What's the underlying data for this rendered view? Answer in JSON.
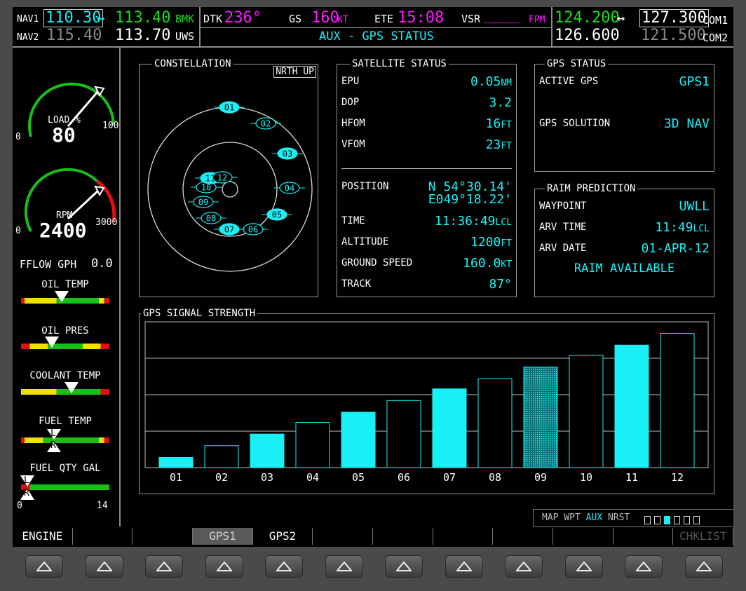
{
  "header": {
    "nav1": {
      "label": "NAV1",
      "active": "110.30",
      "arrow": "↔",
      "standby": "113.40",
      "id": "BMK"
    },
    "nav2": {
      "label": "NAV2",
      "active": "115.40",
      "standby": "113.70",
      "id": "UWS"
    },
    "dtk": {
      "label": "DTK",
      "value": "236°"
    },
    "gs": {
      "label": "GS",
      "value": "160",
      "unit": "KT"
    },
    "ete": {
      "label": "ETE",
      "value": "15:08"
    },
    "vsr": {
      "label": "VSR",
      "value": "_____",
      "unit": "FPM"
    },
    "page_title": "AUX - GPS STATUS",
    "com1": {
      "label": "COM1",
      "active": "124.200",
      "arrow": "↔",
      "standby": "127.300"
    },
    "com2": {
      "label": "COM2",
      "active": "126.600",
      "standby": "121.500"
    }
  },
  "engine": {
    "load": {
      "label": "LOAD %",
      "value": "80",
      "min": "0",
      "max": "100"
    },
    "rpm": {
      "label": "RPM",
      "value": "2400",
      "min": "0",
      "max": "3000"
    },
    "fflow": {
      "label": "FFLOW GPH",
      "value": "0.0"
    },
    "oil_temp": {
      "label": "OIL TEMP"
    },
    "oil_pres": {
      "label": "OIL PRES"
    },
    "coolant_temp": {
      "label": "COOLANT TEMP"
    },
    "fuel_temp": {
      "label": "FUEL TEMP",
      "left": "L",
      "right": "R"
    },
    "fuel_qty": {
      "label": "FUEL QTY GAL",
      "min": "0",
      "max": "14",
      "left": "L",
      "right": "R"
    }
  },
  "constellation": {
    "title": "CONSTELLATION",
    "mode_button": "NRTH UP",
    "satellites": [
      {
        "id": "01",
        "filled": true
      },
      {
        "id": "02",
        "filled": false
      },
      {
        "id": "03",
        "filled": true
      },
      {
        "id": "04",
        "filled": false
      },
      {
        "id": "05",
        "filled": true
      },
      {
        "id": "06",
        "filled": false
      },
      {
        "id": "07",
        "filled": true
      },
      {
        "id": "08",
        "filled": false
      },
      {
        "id": "09",
        "filled": false
      },
      {
        "id": "10",
        "filled": false
      },
      {
        "id": "11",
        "filled": true
      },
      {
        "id": "12",
        "filled": false
      }
    ]
  },
  "satellite_status": {
    "title": "SATELLITE STATUS",
    "epu": {
      "label": "EPU",
      "value": "0.05",
      "unit": "NM"
    },
    "dop": {
      "label": "DOP",
      "value": "3.2"
    },
    "hfom": {
      "label": "HFOM",
      "value": "16",
      "unit": "FT"
    },
    "vfom": {
      "label": "VFOM",
      "value": "23",
      "unit": "FT"
    },
    "position": {
      "label": "POSITION",
      "lat": "N 54°30.14'",
      "lon": "E049°18.22'"
    },
    "time": {
      "label": "TIME",
      "value": "11:36:49",
      "unit": "LCL"
    },
    "altitude": {
      "label": "ALTITUDE",
      "value": "1200",
      "unit": "FT"
    },
    "ground_speed": {
      "label": "GROUND SPEED",
      "value": "160.0",
      "unit": "KT"
    },
    "track": {
      "label": "TRACK",
      "value": "87°"
    }
  },
  "gps_status": {
    "title": "GPS STATUS",
    "active_gps": {
      "label": "ACTIVE GPS",
      "value": "GPS1"
    },
    "solution": {
      "label": "GPS SOLUTION",
      "value": "3D NAV"
    }
  },
  "raim": {
    "title": "RAIM PREDICTION",
    "waypoint": {
      "label": "WAYPOINT",
      "value": "UWLL"
    },
    "arv_time": {
      "label": "ARV TIME",
      "value": "11:49",
      "unit": "LCL"
    },
    "arv_date": {
      "label": "ARV DATE",
      "value": "01-APR-12"
    },
    "status": "RAIM AVAILABLE"
  },
  "chart_data": {
    "type": "bar",
    "title": "GPS SIGNAL STRENGTH",
    "categories": [
      "01",
      "02",
      "03",
      "04",
      "05",
      "06",
      "07",
      "08",
      "09",
      "10",
      "11",
      "12"
    ],
    "values": [
      0.07,
      0.15,
      0.23,
      0.31,
      0.38,
      0.46,
      0.54,
      0.61,
      0.69,
      0.77,
      0.84,
      0.92
    ],
    "state": [
      "filled",
      "hollow",
      "filled",
      "hollow",
      "filled",
      "hollow",
      "filled",
      "hollow",
      "hatched",
      "hollow",
      "filled",
      "hollow"
    ],
    "ylim": [
      0,
      1
    ],
    "grid": true,
    "colors": {
      "bar": "#19f0f5",
      "outline": "#19f0f5"
    }
  },
  "page_group": {
    "items": [
      "MAP",
      "WPT",
      "AUX",
      "NRST"
    ],
    "active": "AUX",
    "dots": 6,
    "active_dot": 3
  },
  "softkeys": [
    "ENGINE",
    "",
    "",
    "GPS1",
    "GPS2",
    "",
    "",
    "",
    "",
    "",
    "",
    "CHKLIST"
  ],
  "colors": {
    "cyan": "#19f0f5",
    "green": "#18e018",
    "magenta": "#ff19ff",
    "background": "#000000"
  }
}
